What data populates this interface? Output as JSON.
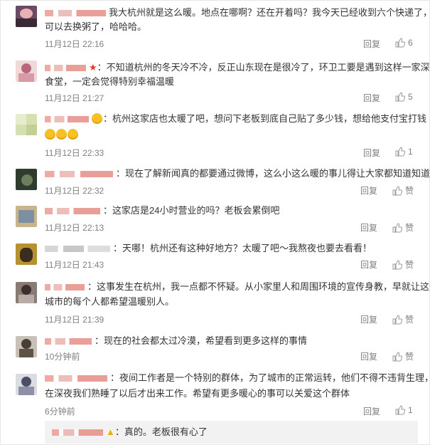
{
  "comments": [
    {
      "content": "我大杭州就是这么暖。地点在哪啊？还在开着吗？我今天已经收到六个快递了，",
      "content2": "可以去换粥了，哈哈哈。",
      "time": "11月12日 22:16",
      "reply": "回复",
      "likes": "6"
    },
    {
      "content": "不知道杭州的冬天冷不冷，反正山东现在是很冷了，环卫工要是遇到这样一家深夜",
      "content2": "食堂，一定会觉得特别幸福温暖",
      "time": "11月12日 21:27",
      "reply": "回复",
      "likes": "5"
    },
    {
      "content": "杭州这家店也太暖了吧，想问下老板到底自己贴了多少钱，想给他支付宝打钱",
      "content2": "",
      "time": "11月12日 22:33",
      "reply": "回复",
      "likes": "1"
    },
    {
      "content": "现在了解新闻真的都要通过微博，这么小这么暖的事儿得让大家都知道知道啊",
      "content2": "",
      "time": "11月12日 22:32",
      "reply": "回复",
      "likes": "赞"
    },
    {
      "content": "这家店是24小时营业的吗？老板会累倒吧",
      "content2": "",
      "time": "11月12日 22:13",
      "reply": "回复",
      "likes": "赞"
    },
    {
      "content": "天哪！杭州还有这种好地方？太暖了吧～我熬夜也要去看看！",
      "content2": "",
      "time": "11月12日 21:43",
      "reply": "回复",
      "likes": "赞"
    },
    {
      "content": "这事发生在杭州，我一点都不怀疑。从小家里人和周围环境的宣传身教，早就让这个",
      "content2": "城市的每个人都希望温暖别人。",
      "time": "11月12日 21:39",
      "reply": "回复",
      "likes": "赞"
    },
    {
      "content": "现在的社会都太过冷漠，希望看到更多这样的事情",
      "content2": "",
      "time": "10分钟前",
      "reply": "回复",
      "likes": "赞"
    },
    {
      "content": "夜间工作者是一个特别的群体，为了城市的正常运转，他们不得不违背生理，",
      "content2": "在深夜我们熟睡了以后才出来工作。希望有更多暖心的事可以关爱这个群体",
      "time": "6分钟前",
      "reply": "回复",
      "likes": "1"
    }
  ],
  "sub_reply": {
    "content": "真的。老板很有心了"
  },
  "colors": {
    "text": "#333333",
    "meta": "#808080",
    "sub_bg": "#f2f2f2"
  },
  "icons": {
    "like": "thumbs-up-icon"
  }
}
